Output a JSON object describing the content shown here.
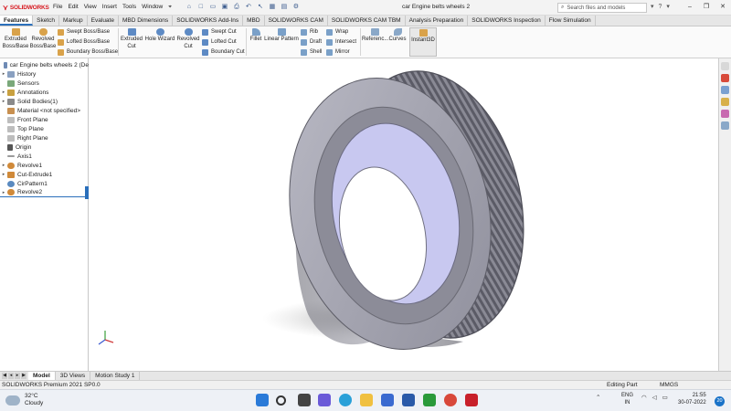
{
  "app": {
    "logo_text": "SOLIDWORKS",
    "menus": [
      "File",
      "Edit",
      "View",
      "Insert",
      "Tools",
      "Window"
    ],
    "document_title": "car  Engine belts wheels 2",
    "search_placeholder": "Search files and models"
  },
  "command_tabs": [
    "Features",
    "Sketch",
    "Markup",
    "Evaluate",
    "MBD Dimensions",
    "SOLIDWORKS Add-Ins",
    "MBD",
    "SOLIDWORKS CAM",
    "SOLIDWORKS CAM TBM",
    "Analysis Preparation",
    "SOLIDWORKS Inspection",
    "Flow Simulation"
  ],
  "ribbon": {
    "extruded_boss": "Extruded",
    "extruded_boss2": "Boss/Base",
    "revolved_boss": "Revolved",
    "revolved_boss2": "Boss/Base",
    "swept_boss": "Swept Boss/Base",
    "lofted_boss": "Lofted Boss/Base",
    "boundary_boss": "Boundary Boss/Base",
    "extruded_cut": "Extruded",
    "extruded_cut2": "Cut",
    "hole_wizard": "Hole Wizard",
    "revolved_cut": "Revolved",
    "revolved_cut2": "Cut",
    "swept_cut": "Swept Cut",
    "lofted_cut": "Lofted Cut",
    "boundary_cut": "Boundary Cut",
    "fillet": "Fillet",
    "linear_pattern": "Linear Pattern",
    "rib": "Rib",
    "draft": "Draft",
    "shell": "Shell",
    "wrap": "Wrap",
    "intersect": "Intersect",
    "mirror": "Mirror",
    "reference": "Referenc...",
    "curves": "Curves",
    "instant3d": "Instant3D"
  },
  "tree": [
    {
      "label": "car  Engine belts wheels 2  (De",
      "arrow": "",
      "color": "#6f8bb5"
    },
    {
      "label": "History",
      "arrow": "▸",
      "color": "#8aa0c0"
    },
    {
      "label": "Sensors",
      "arrow": "",
      "color": "#7aa87a"
    },
    {
      "label": "Annotations",
      "arrow": "▸",
      "color": "#c8a040"
    },
    {
      "label": "Solid Bodies(1)",
      "arrow": "▸",
      "color": "#8a8a8a"
    },
    {
      "label": "Material <not specified>",
      "arrow": "",
      "color": "#c89050"
    },
    {
      "label": "Front Plane",
      "arrow": "",
      "color": "#bdbdbd"
    },
    {
      "label": "Top Plane",
      "arrow": "",
      "color": "#bdbdbd"
    },
    {
      "label": "Right Plane",
      "arrow": "",
      "color": "#bdbdbd"
    },
    {
      "label": "Origin",
      "arrow": "",
      "color": "#555555"
    },
    {
      "label": "Axis1",
      "arrow": "",
      "color": "#9a9a9a"
    },
    {
      "label": "Revolve1",
      "arrow": "▸",
      "color": "#d08a3a"
    },
    {
      "label": "Cut-Extrude1",
      "arrow": "▸",
      "color": "#d08a3a"
    },
    {
      "label": "CirPattern1",
      "arrow": "",
      "color": "#5a8ac0"
    },
    {
      "label": "Revolve2",
      "arrow": "▸",
      "color": "#d08a3a"
    }
  ],
  "bottom_tabs": [
    "Model",
    "3D Views",
    "Motion Study 1"
  ],
  "status": {
    "left": "SOLIDWORKS Premium 2021 SP0.0",
    "mode": "Editing Part",
    "units": "MMGS"
  },
  "taskbar": {
    "temperature": "32°C",
    "weather": "Cloudy",
    "lang1": "ENG",
    "lang2": "IN",
    "time": "21:55",
    "date": "30-07-2022",
    "notifications": "20"
  },
  "colors": {
    "accent": "#2a6fbb",
    "brand": "#d71920"
  }
}
